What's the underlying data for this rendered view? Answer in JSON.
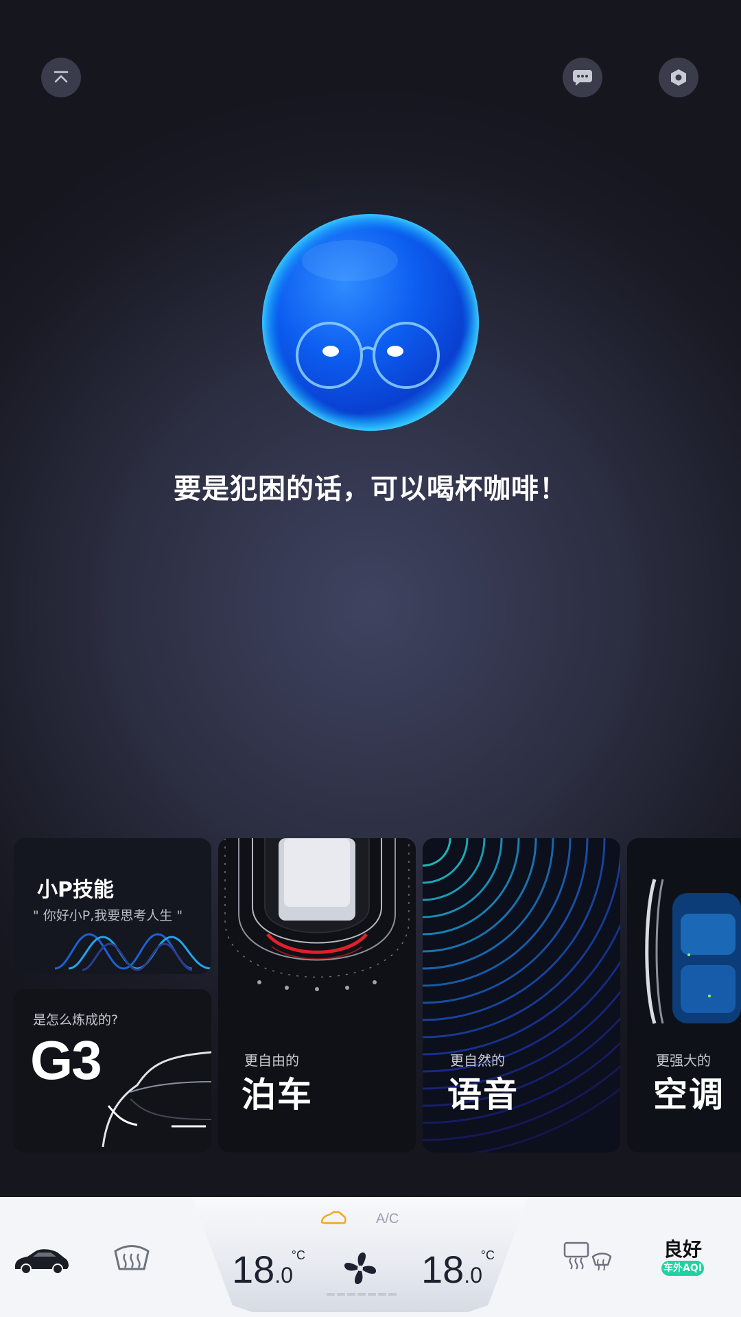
{
  "header": {
    "collapse_icon": "collapse-up-icon",
    "chat_icon": "chat-bubble-icon",
    "settings_icon": "settings-hexagon-icon"
  },
  "assistant": {
    "message": "要是犯困的话，可以喝杯咖啡！"
  },
  "cards": {
    "skills": {
      "title": "小P技能",
      "subtitle": "\" 你好小P,我要思考人生 \""
    },
    "g3": {
      "subtitle": "是怎么炼成的?",
      "title": "G3"
    },
    "parking": {
      "subtitle": "更自由的",
      "title": "泊车"
    },
    "voice": {
      "subtitle": "更自然的",
      "title": "语音"
    },
    "ac": {
      "subtitle": "更强大的",
      "title": "空调"
    }
  },
  "climate": {
    "ac_label": "A/C",
    "left_temp_int": "18",
    "left_temp_dec": ".0",
    "right_temp_int": "18",
    "right_temp_dec": ".0",
    "unit": "°C",
    "fan_level_segments": 7
  },
  "aqi": {
    "status": "良好",
    "label": "车外AQI"
  },
  "colors": {
    "accent_orange": "#f5a623",
    "aqi_green": "#1fd2a0"
  }
}
